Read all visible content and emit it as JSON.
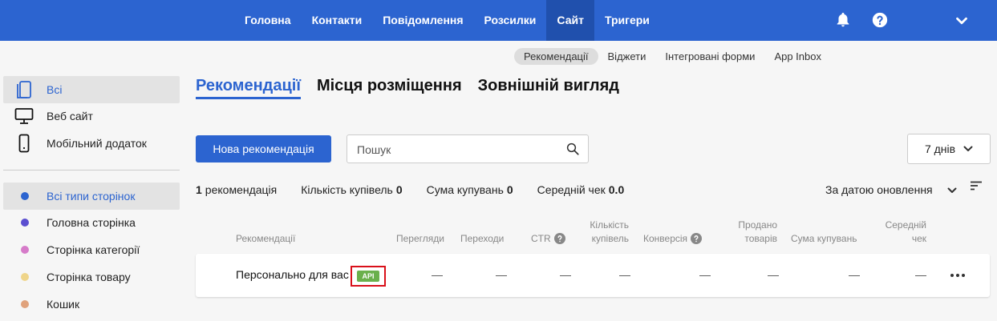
{
  "nav": {
    "items": [
      "Головна",
      "Контакти",
      "Повідомлення",
      "Розсилки",
      "Сайт",
      "Тригери"
    ],
    "active": "Сайт"
  },
  "icons": {
    "bell": "bell-icon",
    "help": "help-circle-icon",
    "account_menu": "chevron-down-icon"
  },
  "subnav": {
    "items": [
      "Рекомендації",
      "Віджети",
      "Інтегровані форми",
      "App Inbox"
    ],
    "active": "Рекомендації"
  },
  "sidebar": {
    "platforms": [
      {
        "label": "Всі",
        "icon": "all-devices-icon"
      },
      {
        "label": "Веб сайт",
        "icon": "desktop-icon"
      },
      {
        "label": "Мобільний додаток",
        "icon": "mobile-icon"
      }
    ],
    "page_types": [
      {
        "label": "Всі типи сторінок",
        "color": "#2c64d0"
      },
      {
        "label": "Головна сторінка",
        "color": "#5b4fd0"
      },
      {
        "label": "Сторінка категорії",
        "color": "#d67bc9"
      },
      {
        "label": "Сторінка товару",
        "color": "#efd58a"
      },
      {
        "label": "Кошик",
        "color": "#e0a27c"
      }
    ]
  },
  "tabs": [
    "Рекомендації",
    "Місця розміщення",
    "Зовнішній вигляд"
  ],
  "toolbar": {
    "new_button": "Нова рекомендація",
    "search_placeholder": "Пошук",
    "period": "7 днів"
  },
  "stats": {
    "count_value": "1",
    "count_label": "рекомендація",
    "purchases_label": "Кількість купівель",
    "purchases_value": "0",
    "sum_label": "Сума купувань",
    "sum_value": "0",
    "avg_label": "Середній чек",
    "avg_value": "0.0",
    "sort_label": "За датою оновлення"
  },
  "table": {
    "headers": {
      "name": "Рекомендації",
      "views": "Перегляди",
      "clicks": "Переходи",
      "ctr": "CTR",
      "purchases_1": "Кількість",
      "purchases_2": "купівель",
      "conversion": "Конверсія",
      "sold_1": "Продано",
      "sold_2": "товарів",
      "sum": "Сума купувань",
      "avg_1": "Середній",
      "avg_2": "чек"
    },
    "rows": [
      {
        "name": "Персонально для вас",
        "badge": "API",
        "views": "—",
        "clicks": "—",
        "ctr": "—",
        "purchases": "—",
        "conversion": "—",
        "sold": "—",
        "sum": "—",
        "avg": "—"
      }
    ]
  }
}
